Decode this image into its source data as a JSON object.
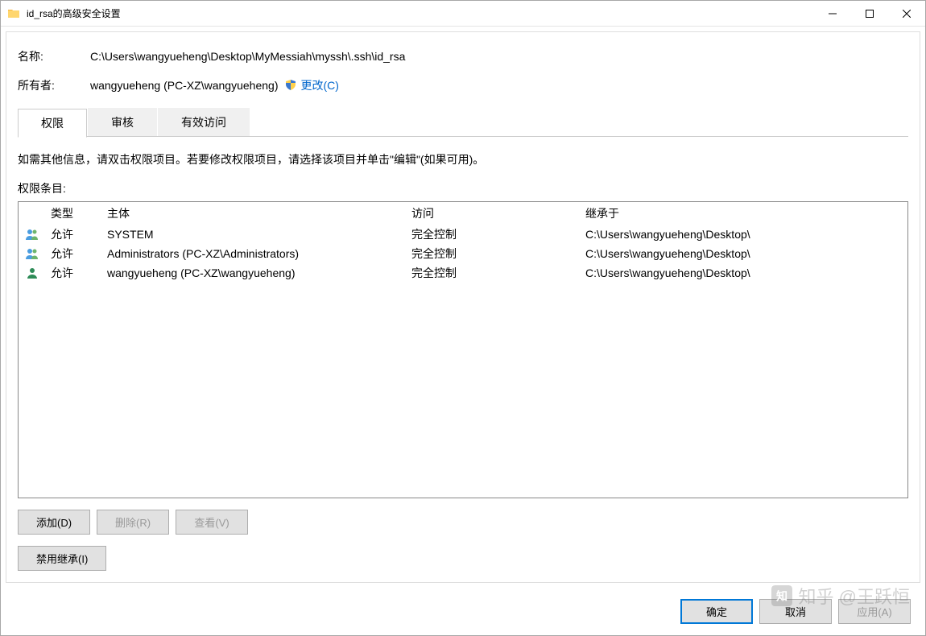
{
  "window": {
    "title": "id_rsa的高级安全设置"
  },
  "info": {
    "name_label": "名称:",
    "name_value": "C:\\Users\\wangyueheng\\Desktop\\MyMessiah\\myssh\\.ssh\\id_rsa",
    "owner_label": "所有者:",
    "owner_value": "wangyueheng (PC-XZ\\wangyueheng)",
    "change_link": "更改(C)"
  },
  "tabs": {
    "permissions": "权限",
    "audit": "审核",
    "effective": "有效访问"
  },
  "instructions": "如需其他信息，请双击权限项目。若要修改权限项目，请选择该项目并单击\"编辑\"(如果可用)。",
  "section_label": "权限条目:",
  "columns": {
    "type": "类型",
    "principal": "主体",
    "access": "访问",
    "inherit": "继承于"
  },
  "entries": [
    {
      "icon": "people",
      "type": "允许",
      "principal": "SYSTEM",
      "access": "完全控制",
      "inherit": "C:\\Users\\wangyueheng\\Desktop\\"
    },
    {
      "icon": "people",
      "type": "允许",
      "principal": "Administrators (PC-XZ\\Administrators)",
      "access": "完全控制",
      "inherit": "C:\\Users\\wangyueheng\\Desktop\\"
    },
    {
      "icon": "person",
      "type": "允许",
      "principal": "wangyueheng (PC-XZ\\wangyueheng)",
      "access": "完全控制",
      "inherit": "C:\\Users\\wangyueheng\\Desktop\\"
    }
  ],
  "buttons": {
    "add": "添加(D)",
    "remove": "删除(R)",
    "view": "查看(V)",
    "disable_inherit": "禁用继承(I)",
    "ok": "确定",
    "cancel": "取消",
    "apply": "应用(A)"
  },
  "watermark": "知乎 @王跃恒"
}
